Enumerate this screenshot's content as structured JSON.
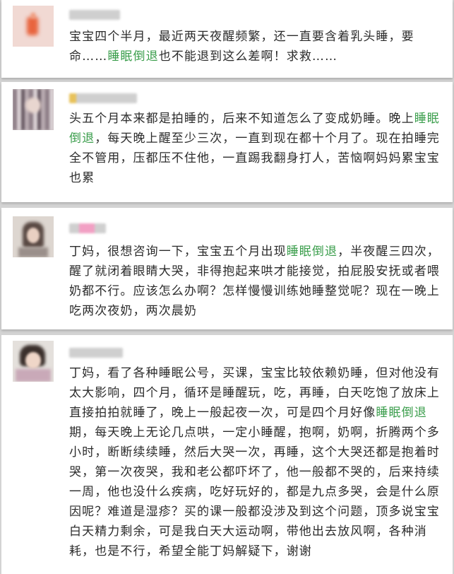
{
  "colors": {
    "highlight": "#3b9e4c",
    "text": "#2b2b2b",
    "background": "#d3d3d3"
  },
  "comments": [
    {
      "segments": [
        "宝宝四个半月，最近两天夜醒频繁，还一直要含着乳头睡，要命……",
        "睡眠倒退",
        "也不能退到这么差啊！求救……"
      ]
    },
    {
      "segments": [
        "头五个月本来都是拍睡的，后来不知道怎么了变成奶睡。晚上",
        "睡眠倒退",
        "，每天晚上醒至少三次，一直到现在都十个月了。现在拍睡完全不管用，压都压不住他，一直踢我翻身打人，苦恼啊妈妈累宝宝也累"
      ]
    },
    {
      "segments": [
        "丁妈，很想咨询一下，宝宝五个月出现",
        "睡眠倒退",
        "，半夜醒三四次，醒了就闭着眼睛大哭，非得抱起来哄才能接觉，拍屁股安抚或者喂奶都不行。应该怎么办啊？怎样慢慢训练她睡整觉呢？现在一晚上吃两次夜奶，两次晨奶"
      ]
    },
    {
      "segments": [
        "丁妈，看了各种睡眠公号，买课，宝宝比较依赖奶睡，但对他没有太大影响，四个月，循环是睡醒玩，吃，再睡，白天吃饱了放床上直接拍拍就睡了，晚上一般起夜一次，可是四个月好像",
        "睡眠倒退",
        "期，每天晚上无论几点哄，一定小睡醒，抱啊，奶啊，折腾两个多小时，断断续续睡，然后大哭一次，再睡，这个大哭还都是抱着时哭，第一次夜哭，我和老公都吓坏了，他一般都不哭的，后来持续一周，他也没什么疾病，吃好玩好的，都是九点多哭，会是什么原因呢？难道是湿疹？买的课一般都没涉及到这个问题，顶多说宝宝白天精力剩余，可是我白天大运动啊，带他出去放风啊，各种消耗，也是不行，希望全能丁妈解疑下，谢谢"
      ]
    }
  ]
}
